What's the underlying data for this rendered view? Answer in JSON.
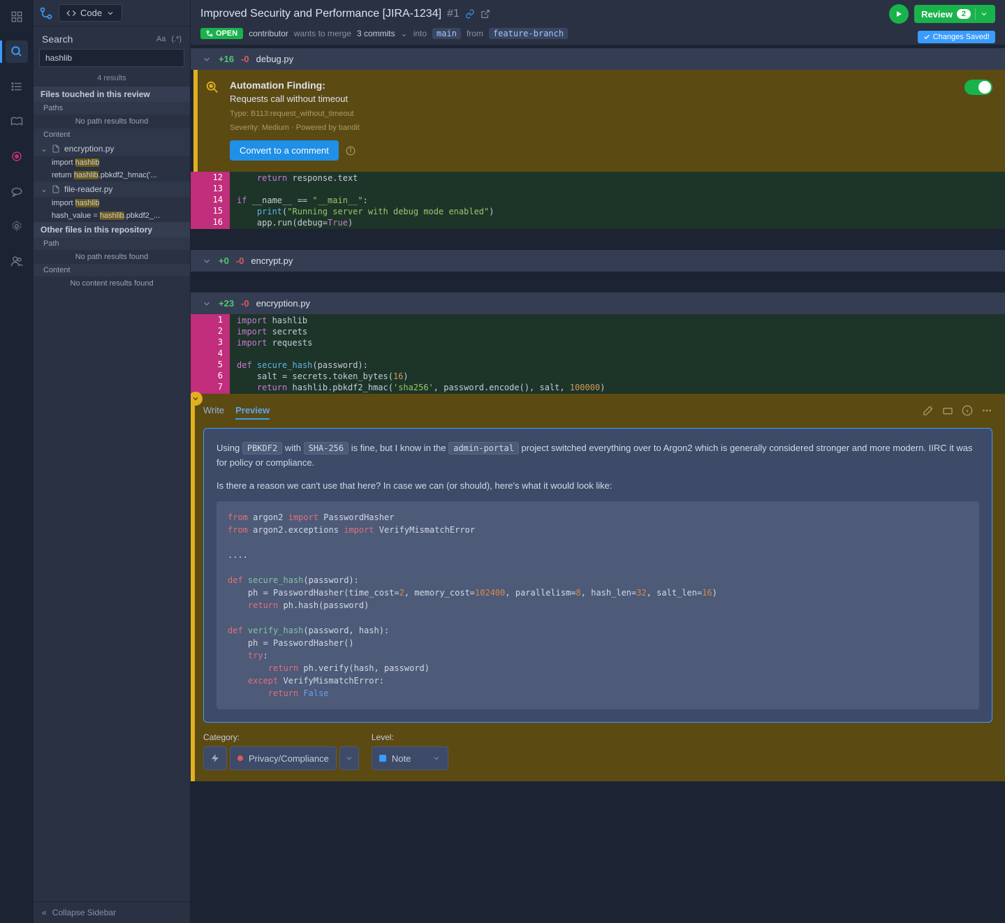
{
  "topbar": {
    "code_label": "Code",
    "title": "Improved Security and Performance [JIRA-1234]",
    "pr_number": "#1",
    "open_badge": "OPEN",
    "meta_prefix": "contributor",
    "meta_wants": "wants to merge",
    "meta_commits": "3 commits",
    "meta_into": "into",
    "branch_main": "main",
    "meta_from": "from",
    "branch_feature": "feature-branch",
    "review_label": "Review",
    "review_count": "2",
    "saved_label": "Changes Saved!"
  },
  "search": {
    "title": "Search",
    "aa": "Aa",
    "regex": "(.*)",
    "value": "hashlib",
    "results": "4 results",
    "files_touched": "Files touched in this review",
    "paths": "Paths",
    "no_paths": "No path results found",
    "content": "Content",
    "file1": "encryption.py",
    "file1_m1_pre": "import ",
    "file1_m1_hl": "hashlib",
    "file1_m2_pre": "return ",
    "file1_m2_hl": "hashlib",
    "file1_m2_post": ".pbkdf2_hmac('...",
    "file2": "file-reader.py",
    "file2_m1_pre": "import ",
    "file2_m1_hl": "hashlib",
    "file2_m2_pre": "hash_value = ",
    "file2_m2_hl": "hashlib",
    "file2_m2_post": ".pbkdf2_...",
    "other_files": "Other files in this repository",
    "path_label": "Path",
    "content_label2": "Content",
    "no_content": "No content results found",
    "collapse": "Collapse Sidebar"
  },
  "files": {
    "debug": {
      "name": "debug.py",
      "add": "+16",
      "del": "-0",
      "finding_title": "Automation Finding:",
      "finding_desc": "Requests call without timeout",
      "finding_type": "Type: B113:request_without_timeout",
      "finding_sev": "Severity: Medium · Powered by bandit",
      "convert": "Convert to a comment",
      "lines": {
        "12": "    return response.text",
        "13": "",
        "14": "if __name__ == \"__main__\":",
        "15": "    print(\"Running server with debug mode enabled\")",
        "16": "    app.run(debug=True)"
      }
    },
    "encrypt": {
      "name": "encrypt.py",
      "add": "+0",
      "del": "-0"
    },
    "encryption": {
      "name": "encryption.py",
      "add": "+23",
      "del": "-0",
      "lines": {
        "1": "import hashlib",
        "2": "import secrets",
        "3": "import requests",
        "4": "",
        "5": "def secure_hash(password):",
        "6": "    salt = secrets.token_bytes(16)",
        "7": "    return hashlib.pbkdf2_hmac('sha256', password.encode(), salt, 100000)"
      }
    }
  },
  "comment": {
    "write_tab": "Write",
    "preview_tab": "Preview",
    "p1_pre": "Using ",
    "p1_c1": "PBKDF2",
    "p1_mid1": " with ",
    "p1_c2": "SHA-256",
    "p1_mid2": " is fine, but I know in the ",
    "p1_c3": "admin-portal",
    "p1_post": " project switched everything over to Argon2 which is generally considered stronger and more modern. IIRC it was for policy or compliance.",
    "p2": "Is there a reason we can't use that here? In case we can (or should), here's what it would look like:",
    "code": "from argon2 import PasswordHasher\nfrom argon2.exceptions import VerifyMismatchError\n\n....\n\ndef secure_hash(password):\n    ph = PasswordHasher(time_cost=2, memory_cost=102400, parallelism=8, hash_len=32, salt_len=16)\n    return ph.hash(password)\n\ndef verify_hash(password, hash):\n    ph = PasswordHasher()\n    try:\n        return ph.verify(hash, password)\n    except VerifyMismatchError:\n        return False",
    "category_label": "Category:",
    "category_value": "Privacy/Compliance",
    "level_label": "Level:",
    "level_value": "Note"
  }
}
